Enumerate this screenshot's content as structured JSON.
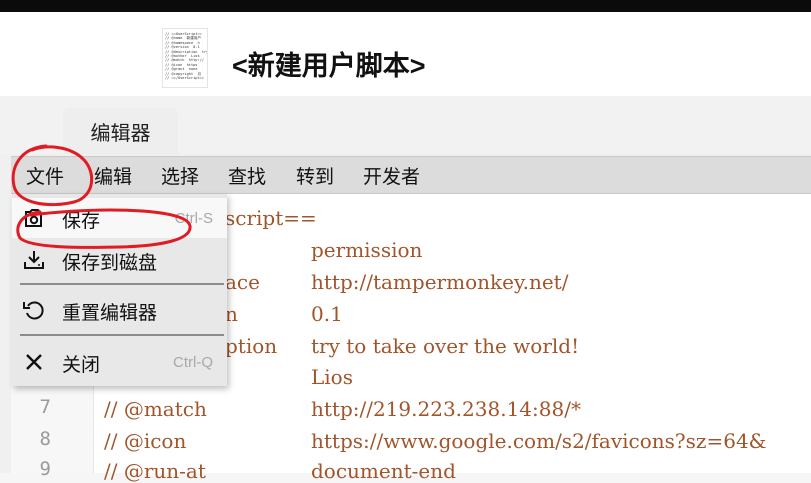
{
  "logo_text": "// ==UserScript==\n// @name  新建用户\n// @namespace  h\n// @version  0.1\n// @description  try\n// @author  Lios\n// @match  http://\n// @icon  https\n// @grant  none\n// @copyright  月\n// ==/UserScript==",
  "header": {
    "title": "<新建用户脚本>"
  },
  "tabs": [
    {
      "label": "编辑器"
    }
  ],
  "menubar": {
    "items": [
      {
        "label": "文件"
      },
      {
        "label": "编辑"
      },
      {
        "label": "选择"
      },
      {
        "label": "查找"
      },
      {
        "label": "转到"
      },
      {
        "label": "开发者"
      }
    ]
  },
  "file_menu": {
    "items": [
      {
        "label": "保存",
        "shortcut": "Ctrl-S",
        "icon": "save-icon"
      },
      {
        "label": "保存到磁盘",
        "shortcut": "",
        "icon": "download-icon"
      },
      {
        "label": "重置编辑器",
        "shortcut": "",
        "icon": "reset-icon"
      },
      {
        "label": "关闭",
        "shortcut": "Ctrl-Q",
        "icon": "close-icon"
      }
    ]
  },
  "editor": {
    "line_numbers": [
      "7",
      "8",
      "9"
    ],
    "lines": [
      {
        "key": "script==",
        "value": ""
      },
      {
        "key": "",
        "value": "permission"
      },
      {
        "key": "ace",
        "value": "http://tampermonkey.net/"
      },
      {
        "key": "n",
        "value": "0.1"
      },
      {
        "key": "ption",
        "value": "try to take over the world!"
      },
      {
        "key": "",
        "value": "Lios"
      },
      {
        "key": "// @match",
        "value": "http://219.223.238.14:88/*"
      },
      {
        "key": "// @icon",
        "value": "https://www.google.com/s2/favicons?sz=64&"
      },
      {
        "key": "// @run-at",
        "value": "document-end"
      }
    ]
  },
  "colors": {
    "menubar_bg": "#dcdcdc",
    "dropdown_bg": "#e8e8e8",
    "code_text": "#a0552a",
    "annotation_red": "#e01b24"
  }
}
